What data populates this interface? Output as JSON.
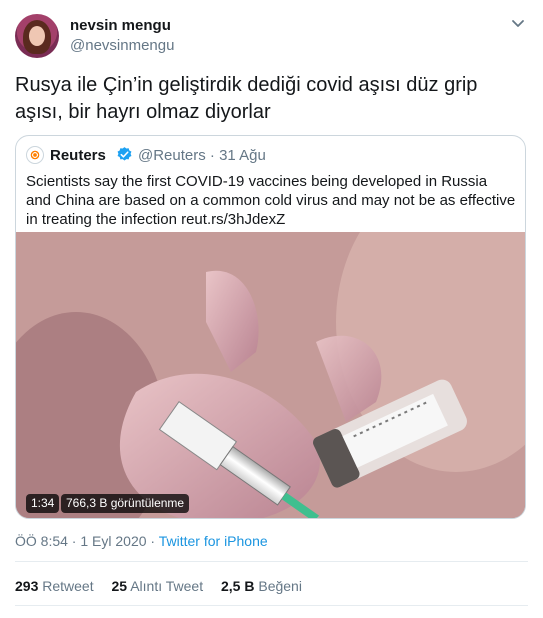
{
  "author": {
    "name": "nevsin mengu",
    "handle": "@nevsinmengu"
  },
  "tweet": {
    "text": "Rusya ile Çin’in geliştirdik dediği covid aşısı düz grip aşısı, bir hayrı olmaz diyorlar"
  },
  "quoted": {
    "name": "Reuters",
    "handle_date": "@Reuters · 31 Ağu",
    "text": "Scientists say the first COVID-19 vaccines being developed in Russia and China are based on a common cold virus and may not be as effective in treating the infection reut.rs/3hJdexZ",
    "video_duration": "1:34",
    "video_views": "766,3 B görüntülenme"
  },
  "meta": {
    "time": "ÖÖ 8:54 · 1 Eyl 2020 · ",
    "source": "Twitter for iPhone"
  },
  "stats": [
    {
      "count": "293",
      "label": "Retweet"
    },
    {
      "count": "25",
      "label": "Alıntı Tweet"
    },
    {
      "count": "2,5 B",
      "label": "Beğeni"
    }
  ],
  "icons": {
    "menu": "chevron-down-icon",
    "verified": "verified-badge-icon"
  },
  "colors": {
    "link": "#1b95e0",
    "secondary": "#657786",
    "verified": "#1da1f2"
  }
}
